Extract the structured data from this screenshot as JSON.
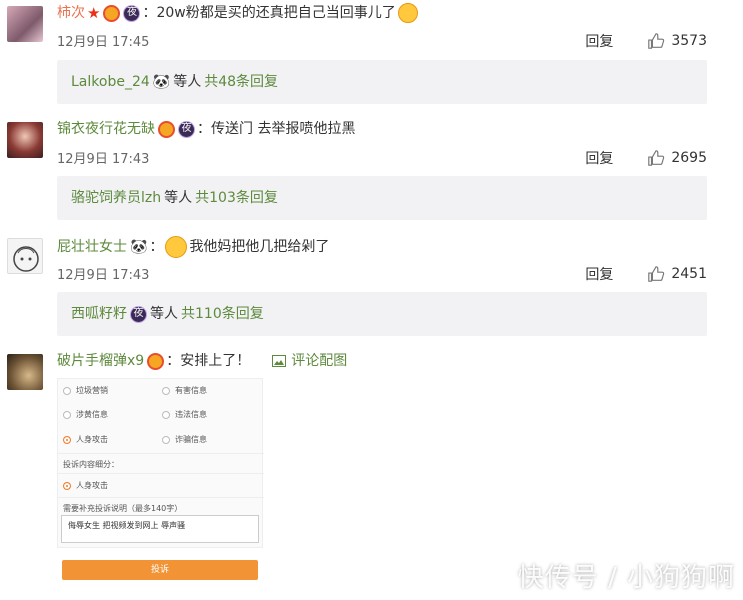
{
  "comments": [
    {
      "username": "柿次",
      "text": "：20w粉都是买的还真把自己当回事儿了",
      "time": "12月9日 17:45",
      "reply_label": "回复",
      "likes": "3573",
      "sub_users": "Lalkobe_24",
      "sub_mid": "等人",
      "sub_count": "共48条回复"
    },
    {
      "username": "锦衣夜行花无缺",
      "text": "：传送门 去举报喷他拉黑",
      "time": "12月9日 17:43",
      "reply_label": "回复",
      "likes": "2695",
      "sub_users": "骆驼饲养员lzh",
      "sub_mid": "等人",
      "sub_count": "共103条回复"
    },
    {
      "username": "屁壮壮女士",
      "text": "我他妈把他几把给剁了",
      "time": "12月9日 17:43",
      "reply_label": "回复",
      "likes": "2451",
      "sub_users": "西呱籽籽",
      "sub_mid": "等人",
      "sub_count": "共110条回复"
    },
    {
      "username": "破片手榴弹x9",
      "text": "：安排上了！",
      "pic_label": "评论配图"
    }
  ],
  "screenshot": {
    "options": [
      "垃圾营销",
      "有害信息",
      "涉黄信息",
      "违法信息",
      "人身攻击",
      "诈骗信息"
    ],
    "section_label": "投诉内容细分：",
    "sub_option": "人身攻击",
    "note_label": "需要补充投诉说明（最多140字）",
    "note_text": "侮辱女生 把视频发到网上 辱声骚",
    "submit": "投诉"
  },
  "watermark": "快传号 / 小狗狗啊",
  "colors": {
    "link_green": "#5d8a3c",
    "name_orange": "#eb7350",
    "sub_bg": "#f2f2f5"
  }
}
